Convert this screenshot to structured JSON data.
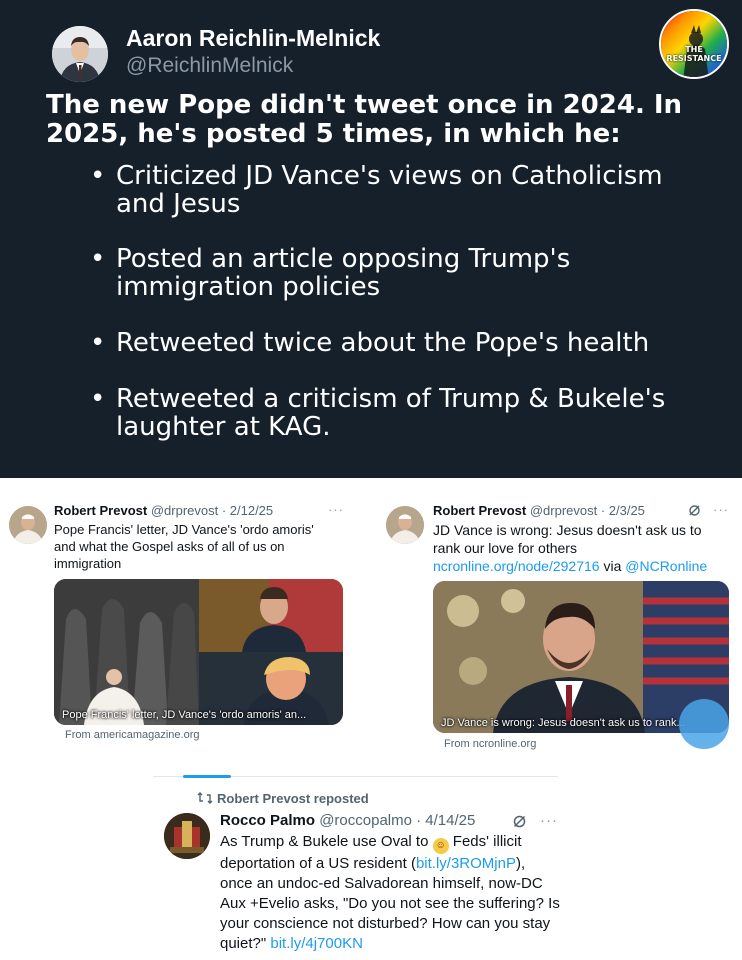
{
  "main_tweet": {
    "author_name": "Aaron Reichlin-Melnick",
    "author_handle": "@ReichlinMelnick",
    "badge_text": "THE RESISTANCE",
    "headline": "The new Pope didn't tweet once in 2024. In 2025, he's posted 5 times, in which he:",
    "bullets": [
      "Criticized JD Vance's views on Catholicism and Jesus",
      "Posted an article opposing Trump's immigration policies",
      "Retweeted twice about the Pope's health",
      "Retweeted a criticism of Trump & Bukele's laughter at KAG."
    ]
  },
  "tweet_left": {
    "name": "Robert Prevost",
    "handle_date": "@drprevost · 2/12/25",
    "text": "Pope Francis' letter, JD Vance's 'ordo amoris' and what the Gospel asks of all of us on immigration",
    "media_caption": "Pope Francis' letter, JD Vance's 'ordo amoris' an...",
    "source": "From americamagazine.org",
    "menu": "···"
  },
  "tweet_right": {
    "name": "Robert Prevost",
    "handle_date": "@drprevost · 2/3/25",
    "text": "JD Vance is wrong: Jesus doesn't ask us to rank our love for others",
    "link": "ncronline.org/node/292716",
    "via": "via",
    "mention": "@NCRonline",
    "media_caption": "JD Vance is wrong: Jesus doesn't ask us to rank...",
    "source": "From ncronline.org",
    "menu": "···"
  },
  "repost": {
    "label": "Robert Prevost reposted",
    "name": "Rocco Palmo",
    "handle_date": "@roccopalmo · 4/14/25",
    "text_1": "As Trump & Bukele use Oval to",
    "text_2": "Feds' illicit deportation of a US resident (",
    "link_1": "bit.ly/3ROMjnP",
    "text_3": "), once an undoc-ed Salvadorean himself, now-DC Aux +Evelio asks, \"Do you not see the suffering? Is your conscience not disturbed? How can you stay quiet?\"",
    "link_2": "bit.ly/4j700KN",
    "menu": "···"
  },
  "colors": {
    "dark_bg": "#15202b",
    "link_blue": "#1d9bf0",
    "muted": "#536471"
  }
}
